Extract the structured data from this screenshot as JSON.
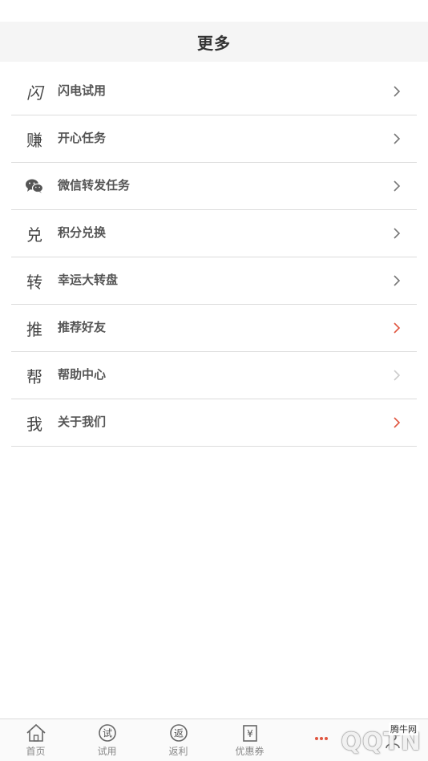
{
  "header": {
    "title": "更多"
  },
  "menu": [
    {
      "lead": "闪",
      "label": "闪电试用",
      "chevron_color": "#777777"
    },
    {
      "lead": "赚",
      "label": "开心任务",
      "chevron_color": "#777777"
    },
    {
      "lead": "wechat-icon",
      "label": "微信转发任务",
      "chevron_color": "#777777"
    },
    {
      "lead": "兑",
      "label": "积分兑换",
      "chevron_color": "#777777"
    },
    {
      "lead": "转",
      "label": "幸运大转盘",
      "chevron_color": "#777777"
    },
    {
      "lead": "推",
      "label": "推荐好友",
      "chevron_color": "#e0553f"
    },
    {
      "lead": "帮",
      "label": "帮助中心",
      "chevron_color": "#cccccc"
    },
    {
      "lead": "我",
      "label": "关于我们",
      "chevron_color": "#e0553f"
    }
  ],
  "tabbar": {
    "tabs": [
      {
        "label": "首页",
        "icon": "home-icon"
      },
      {
        "label": "试用",
        "icon": "trial-icon",
        "icon_text": "试"
      },
      {
        "label": "返利",
        "icon": "rebate-icon",
        "icon_text": "返"
      },
      {
        "label": "优惠券",
        "icon": "coupon-icon",
        "icon_text": "¥"
      },
      {
        "label": "",
        "icon": "more-icon",
        "active": true
      },
      {
        "label": "",
        "icon": "profile-icon"
      }
    ],
    "active_color": "#e0553f"
  },
  "watermark": {
    "text": "QQTN",
    "small": "腾牛网",
    "suffix": ".com"
  }
}
